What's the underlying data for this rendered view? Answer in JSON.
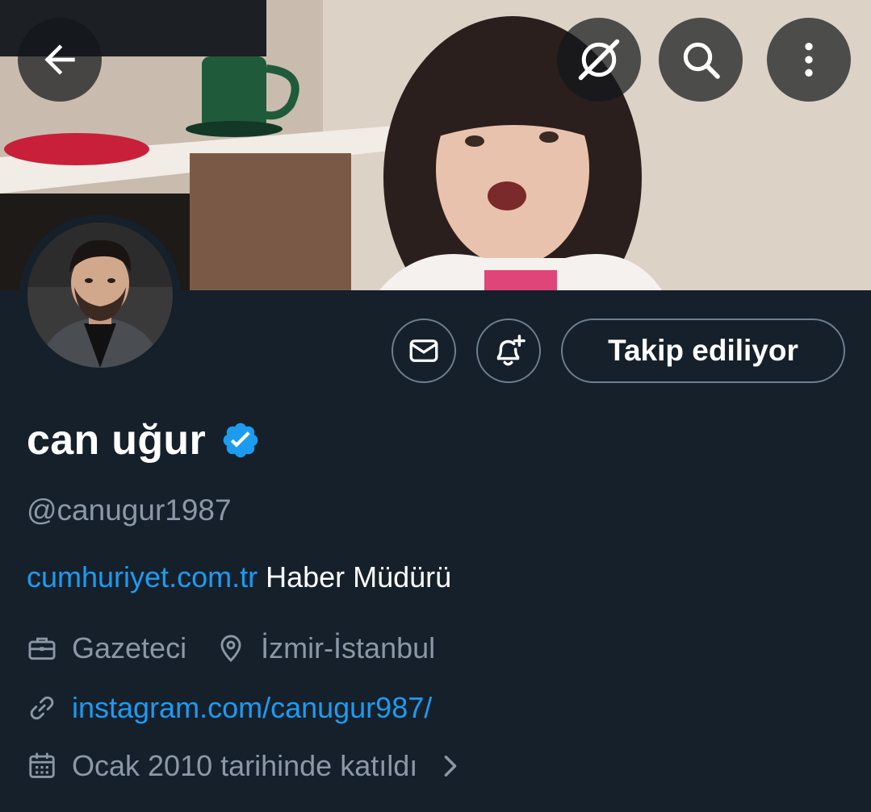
{
  "header": {
    "icons": {
      "back": "back-arrow-icon",
      "grok": "grok-icon",
      "search": "search-icon",
      "more": "more-vertical-icon"
    }
  },
  "profile": {
    "display_name": "can uğur",
    "verified": true,
    "handle": "@canugur1987",
    "bio_link": "cumhuriyet.com.tr",
    "bio_text": " Haber Müdürü",
    "profession": "Gazeteci",
    "location": "İzmir-İstanbul",
    "website": "instagram.com/canugur987/",
    "joined": "Ocak 2010 tarihinde katıldı"
  },
  "actions": {
    "follow_label": "Takip ediliyor"
  },
  "colors": {
    "background": "#15202b",
    "accent": "#1d9bf0",
    "secondary_text": "#8b98a5",
    "border": "#6e7f8d"
  }
}
